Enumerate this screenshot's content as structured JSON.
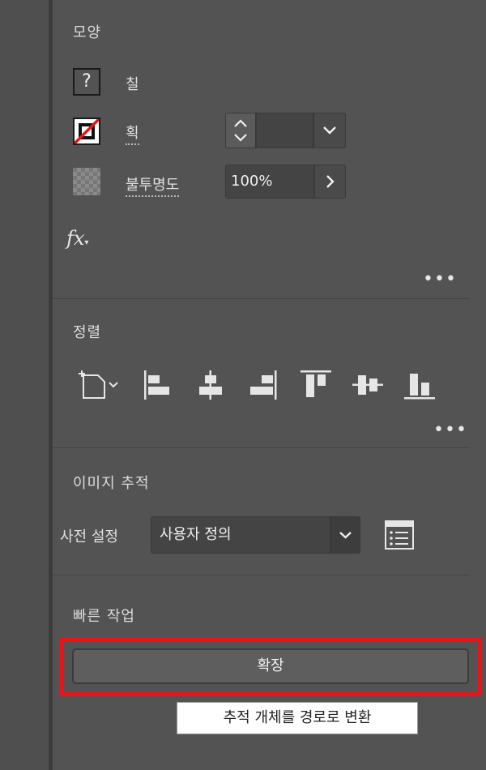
{
  "appearance": {
    "title": "모양",
    "fill_label": "칠",
    "fill_swatch_glyph": "?",
    "stroke_label": "획",
    "stroke_weight_value": "",
    "opacity_label": "불투명도",
    "opacity_value": "100%",
    "fx_label": "fx",
    "more": "•••"
  },
  "align": {
    "title": "정렬",
    "more": "•••",
    "icons": [
      "align-to-selection-icon",
      "align-left-icon",
      "align-horizontal-center-icon",
      "align-right-icon",
      "align-top-icon",
      "align-vertical-center-icon",
      "align-bottom-icon"
    ]
  },
  "image_trace": {
    "title": "이미지 추적",
    "preset_label": "사전 설정",
    "preset_value": "사용자 정의"
  },
  "quick_actions": {
    "title": "빠른 작업",
    "expand_label": "확장",
    "tooltip": "추적 개체를 경로로 변환"
  },
  "colors": {
    "panel_bg": "#535353",
    "highlight": "#e8141a",
    "stroke_slash": "#e8141a"
  }
}
